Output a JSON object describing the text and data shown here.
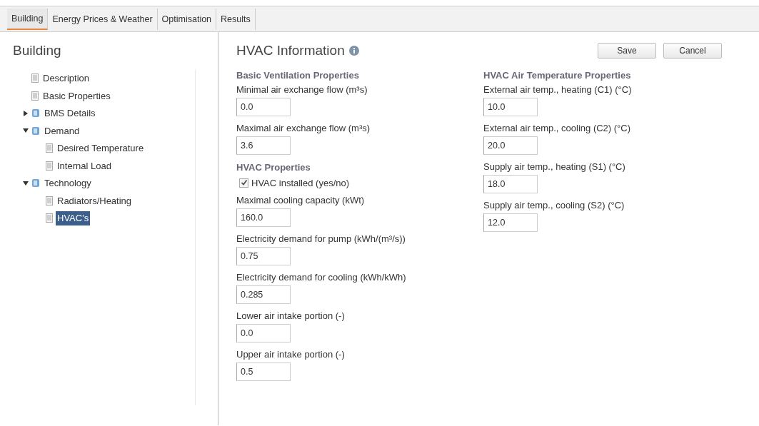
{
  "tabs": [
    {
      "label": "Building",
      "selected": true
    },
    {
      "label": "Energy Prices & Weather",
      "selected": false
    },
    {
      "label": "Optimisation",
      "selected": false
    },
    {
      "label": "Results",
      "selected": false
    }
  ],
  "sidebar": {
    "title": "Building",
    "tree": [
      {
        "kind": "leaf",
        "label": "Description",
        "selected": false
      },
      {
        "kind": "leaf",
        "label": "Basic Properties",
        "selected": false
      },
      {
        "kind": "folder",
        "label": "BMS Details",
        "expanded": false,
        "selected": false
      },
      {
        "kind": "folder",
        "label": "Demand",
        "expanded": true,
        "selected": false,
        "children": [
          {
            "kind": "leaf",
            "label": "Desired Temperature",
            "selected": false
          },
          {
            "kind": "leaf",
            "label": "Internal Load",
            "selected": false
          }
        ]
      },
      {
        "kind": "folder",
        "label": "Technology",
        "expanded": true,
        "selected": false,
        "children": [
          {
            "kind": "leaf",
            "label": "Radiators/Heating",
            "selected": false
          },
          {
            "kind": "leaf",
            "label": "HVAC's",
            "selected": true
          }
        ]
      }
    ]
  },
  "panel": {
    "title": "HVAC Information",
    "buttons": [
      "Save",
      "Cancel"
    ],
    "columns": [
      [
        {
          "heading": "Basic Ventilation Properties",
          "items": [
            {
              "kind": "field",
              "label": "Minimal air exchange flow (m³s)",
              "value": "0.0"
            },
            {
              "kind": "field",
              "label": "Maximal air exchange flow (m³s)",
              "value": "3.6"
            }
          ]
        },
        {
          "heading": "HVAC Properties",
          "items": [
            {
              "kind": "checkbox",
              "label": "HVAC installed (yes/no)",
              "checked": true
            },
            {
              "kind": "field",
              "label": "Maximal cooling capacity (kWt)",
              "value": "160.0"
            },
            {
              "kind": "field",
              "label": "Electricity demand for pump (kWh/(m³/s))",
              "value": "0.75"
            },
            {
              "kind": "field",
              "label": "Electricity demand for cooling (kWh/kWh)",
              "value": "0.285"
            },
            {
              "kind": "field",
              "label": "Lower air intake portion (-)",
              "value": "0.0"
            },
            {
              "kind": "field",
              "label": "Upper air intake portion (-)",
              "value": "0.5"
            }
          ]
        }
      ],
      [
        {
          "heading": "HVAC Air Temperature Properties",
          "items": [
            {
              "kind": "field",
              "label": "External air temp., heating (C1) (°C)",
              "value": "10.0"
            },
            {
              "kind": "field",
              "label": "External air temp., cooling (C2) (°C)",
              "value": "20.0"
            },
            {
              "kind": "field",
              "label": "Supply air temp., heating (S1) (°C)",
              "value": "18.0"
            },
            {
              "kind": "field",
              "label": "Supply air temp., cooling (S2) (°C)",
              "value": "12.0"
            }
          ]
        }
      ]
    ]
  }
}
